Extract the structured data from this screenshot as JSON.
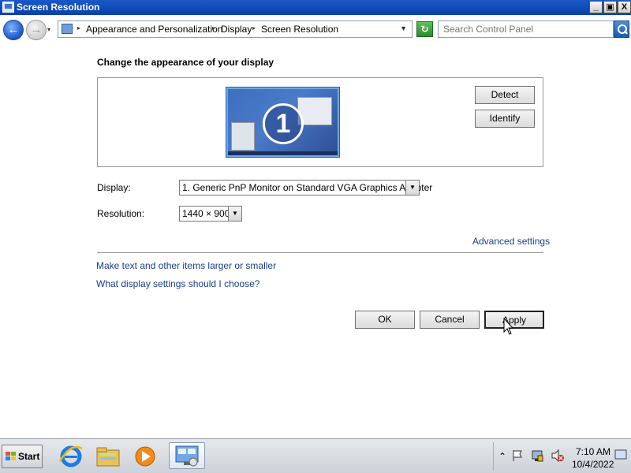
{
  "window": {
    "title": "Screen Resolution",
    "minimize": "_",
    "restore": "▣",
    "close": "X"
  },
  "nav": {
    "back_glyph": "←",
    "forward_glyph": "→",
    "recent_glyph": "▾",
    "breadcrumbs": [
      "Appearance and Personalization",
      "Display",
      "Screen Resolution"
    ],
    "refresh_glyph": "↻",
    "search_placeholder": "Search Control Panel"
  },
  "main": {
    "heading": "Change the appearance of your display",
    "monitor_number": "1",
    "detect_label": "Detect",
    "identify_label": "Identify",
    "display_label": "Display:",
    "display_value": "1. Generic PnP Monitor on Standard VGA Graphics Adapter",
    "resolution_label": "Resolution:",
    "resolution_value": "1440 × 900",
    "advanced_link": "Advanced settings",
    "link_text_size": "Make text and other items larger or smaller",
    "link_help": "What display settings should I choose?",
    "ok_label": "OK",
    "cancel_label": "Cancel",
    "apply_label": "Apply"
  },
  "taskbar": {
    "start_label": "Start",
    "pinned": [
      "internet-explorer",
      "windows-explorer",
      "media-player",
      "control-panel-screen-resolution"
    ],
    "tray_expand": "⌃",
    "clock_time": "7:10 AM",
    "clock_date": "10/4/2022"
  },
  "colors": {
    "titlebar": "#0a3fa8",
    "link": "#1a3e8c",
    "monitor_border": "#6fa8e8"
  }
}
